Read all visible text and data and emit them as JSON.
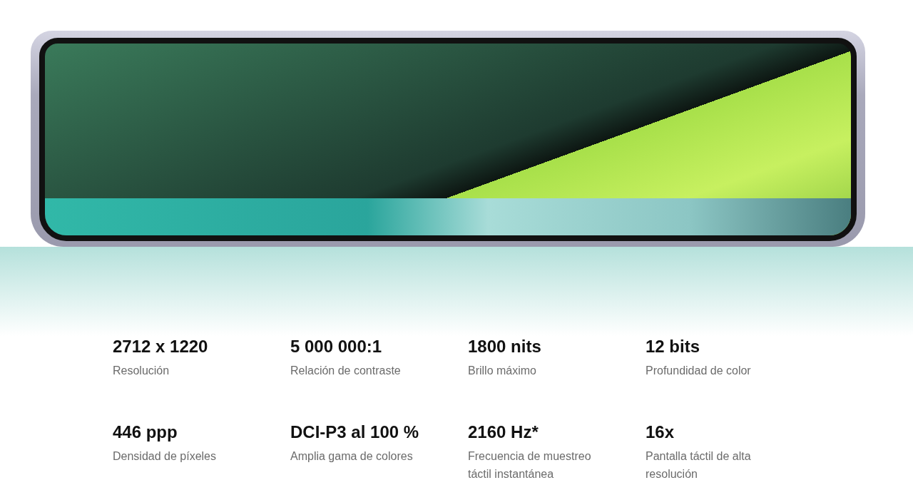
{
  "specs": [
    {
      "value": "2712 x 1220",
      "label": "Resolución"
    },
    {
      "value": "5 000 000:1",
      "label": "Relación de contraste"
    },
    {
      "value": "1800 nits",
      "label": "Brillo máximo"
    },
    {
      "value": "12 bits",
      "label": "Profundidad de color"
    },
    {
      "value": "446 ppp",
      "label": "Densidad de píxeles"
    },
    {
      "value": "DCI-P3 al 100 %",
      "label": "Amplia gama de colores"
    },
    {
      "value": "2160 Hz*",
      "label": "Frecuencia de muestreo táctil instantánea"
    },
    {
      "value": "16x",
      "label": "Pantalla táctil de alta resolución"
    }
  ]
}
